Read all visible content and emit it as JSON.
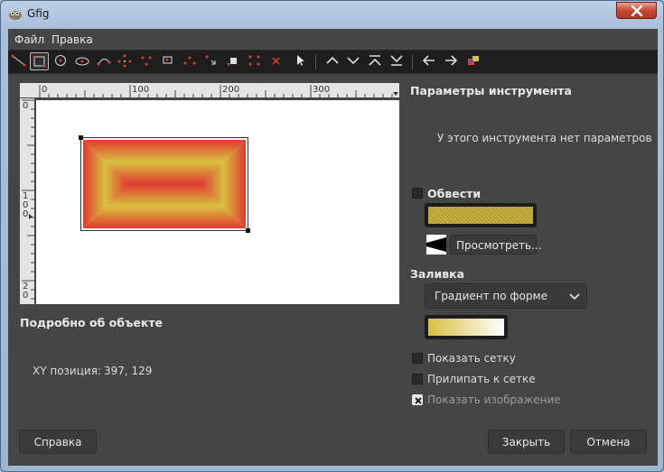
{
  "window": {
    "title": "Gfig"
  },
  "menu": {
    "file": "Файл",
    "edit": "Правка"
  },
  "ruler": {
    "h_ticks": [
      "0",
      "100",
      "200",
      "300"
    ],
    "v_ticks": [
      "0",
      "1",
      "0",
      "0",
      "2",
      "0"
    ]
  },
  "tool_options": {
    "heading": "Параметры инструмента",
    "no_options_text": "У этого инструмента нет параметров"
  },
  "stroke": {
    "label": "Обвести",
    "checked": false,
    "color": "#c8b040",
    "browse_button": "Просмотреть..."
  },
  "fill": {
    "label": "Заливка",
    "type_value": "Градиент по форме",
    "gradient_start": "#d8c040",
    "gradient_end": "#ffffff"
  },
  "object_details": {
    "heading": "Подробно об объекте",
    "xy_label": "XY позиция:",
    "xy_value": "397, 129"
  },
  "grid": {
    "show_grid": {
      "label": "Показать сетку",
      "checked": false
    },
    "snap_grid": {
      "label": "Прилипать к сетке",
      "checked": false
    },
    "show_image": {
      "label": "Показать изображение",
      "checked": true
    }
  },
  "buttons": {
    "help": "Справка",
    "close": "Закрыть",
    "cancel": "Отмена"
  },
  "colors": {
    "dialog_bg": "#454545",
    "toolbar_bg": "#1e1e1e",
    "shape_edge": "#e03a30",
    "shape_center": "#d8c040"
  }
}
